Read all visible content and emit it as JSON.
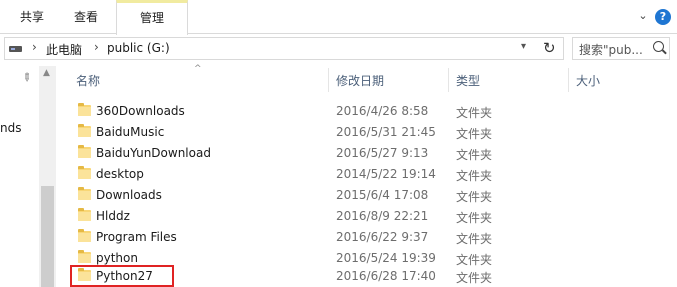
{
  "ribbon": {
    "tabs": [
      {
        "label": "共享"
      },
      {
        "label": "查看"
      },
      {
        "label": "管理"
      }
    ],
    "help_glyph": "?"
  },
  "address": {
    "breadcrumb": [
      "此电脑",
      "public (G:)"
    ],
    "separator": "›"
  },
  "search": {
    "placeholder": "搜索\"pub..."
  },
  "navpane": {
    "partial_item": "nds"
  },
  "columns": {
    "name": "名称",
    "date": "修改日期",
    "type": "类型",
    "size": "大小"
  },
  "files": [
    {
      "name": "360Downloads",
      "date": "2016/4/26 8:58",
      "type": "文件夹"
    },
    {
      "name": "BaiduMusic",
      "date": "2016/5/31 21:45",
      "type": "文件夹"
    },
    {
      "name": "BaiduYunDownload",
      "date": "2016/5/27 9:13",
      "type": "文件夹"
    },
    {
      "name": "desktop",
      "date": "2014/5/22 19:14",
      "type": "文件夹"
    },
    {
      "name": "Downloads",
      "date": "2015/6/4 17:08",
      "type": "文件夹"
    },
    {
      "name": "Hlddz",
      "date": "2016/8/9 22:21",
      "type": "文件夹"
    },
    {
      "name": "Program Files",
      "date": "2016/6/22 9:37",
      "type": "文件夹"
    },
    {
      "name": "python",
      "date": "2016/5/24 19:39",
      "type": "文件夹"
    },
    {
      "name": "Python27",
      "date": "2016/6/28 17:40",
      "type": "文件夹"
    }
  ],
  "colors": {
    "manage_tab_accent": "#f1eba0",
    "highlight_box": "#e02323",
    "header_text": "#4c607a",
    "folder": "#f8d676"
  },
  "icons": [
    "drive-icon",
    "chevron-down-icon",
    "refresh-icon",
    "search-icon",
    "pin-icon",
    "help-icon",
    "folder-icon"
  ]
}
